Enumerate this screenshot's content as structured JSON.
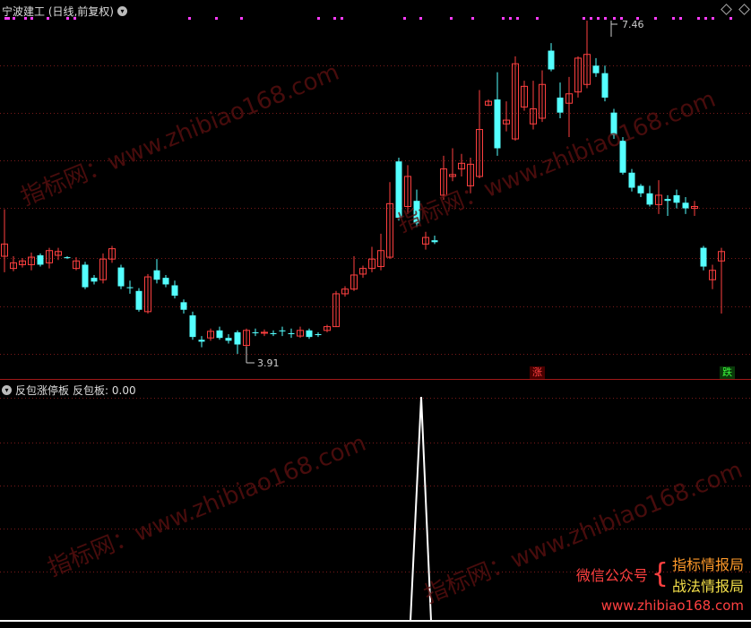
{
  "main_panel": {
    "title": "宁波建工 (日线,前复权)",
    "max_label": "7.46",
    "min_label": "3.91",
    "signal_up": "涨",
    "signal_down": "跌"
  },
  "indicator_panel": {
    "title": "反包涨停板",
    "value_label": "反包板: 0.00"
  },
  "watermark": {
    "site_text": "指标网：www.zhibiao168.com",
    "wechat_label": "微信公众号",
    "account_1": "指标情报局",
    "account_2": "战法情报局",
    "url": "www.zhibiao168.com"
  },
  "colors": {
    "up": "#ff4040",
    "down": "#54ffff",
    "grid": "#7a1a1a",
    "marker": "#ff3cff",
    "spike": "#ffffff",
    "watermark_orange": "#ff9a2a",
    "watermark_yellow": "#f4e04a"
  },
  "chart_data": {
    "type": "candlestick",
    "price_range": [
      3.91,
      7.46
    ],
    "high_mark": 7.46,
    "low_mark": 3.91,
    "indicator_peak_value": 1,
    "indicator_current_value": 0.0
  }
}
